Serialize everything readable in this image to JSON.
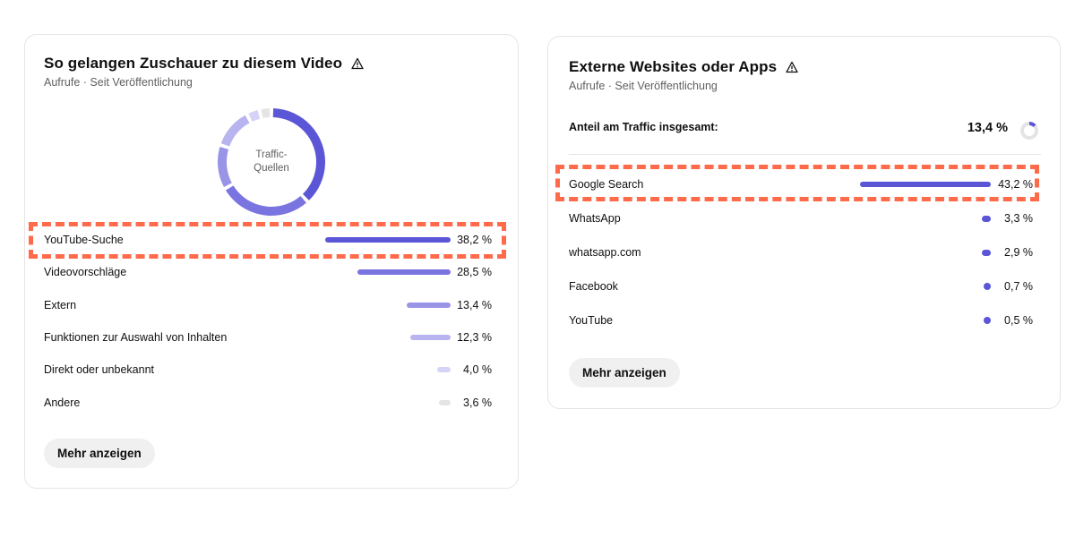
{
  "left_card": {
    "title": "So gelangen Zuschauer zu diesem Video",
    "subtitle": "Aufrufe · Seit Veröffentlichung",
    "donut_label_line1": "Traffic-",
    "donut_label_line2": "Quellen",
    "rows": [
      {
        "label": "YouTube-Suche",
        "value": "38,2 %",
        "fraction": 0.382,
        "color": "#5b56d6"
      },
      {
        "label": "Videovorschläge",
        "value": "28,5 %",
        "fraction": 0.285,
        "color": "#7a74e0"
      },
      {
        "label": "Extern",
        "value": "13,4 %",
        "fraction": 0.134,
        "color": "#9994e6"
      },
      {
        "label": "Funktionen zur Auswahl von Inhalten",
        "value": "12,3 %",
        "fraction": 0.123,
        "color": "#b8b4ef"
      },
      {
        "label": "Direkt oder unbekannt",
        "value": "4,0 %",
        "fraction": 0.04,
        "color": "#d6d4f6"
      },
      {
        "label": "Andere",
        "value": "3,6 %",
        "fraction": 0.036,
        "color": "#e4e4e4"
      }
    ],
    "more_button": "Mehr anzeigen"
  },
  "right_card": {
    "title": "Externe Websites oder Apps",
    "subtitle": "Aufrufe · Seit Veröffentlichung",
    "total_label": "Anteil am Traffic insgesamt:",
    "total_value": "13,4 %",
    "total_fraction": 0.134,
    "rows": [
      {
        "label": "Google Search",
        "value": "43,2 %",
        "fraction": 0.432
      },
      {
        "label": "WhatsApp",
        "value": "3,3 %",
        "fraction": 0.033
      },
      {
        "label": "whatsapp.com",
        "value": "2,9 %",
        "fraction": 0.029
      },
      {
        "label": "Facebook",
        "value": "0,7 %",
        "fraction": 0.007
      },
      {
        "label": "YouTube",
        "value": "0,5 %",
        "fraction": 0.005
      }
    ],
    "more_button": "Mehr anzeigen"
  },
  "colors": {
    "accent": "#5b56d6",
    "highlight": "#ff6b4a",
    "button_bg": "#f0f0f0"
  },
  "icons": {
    "warning": "warning-triangle-icon"
  }
}
